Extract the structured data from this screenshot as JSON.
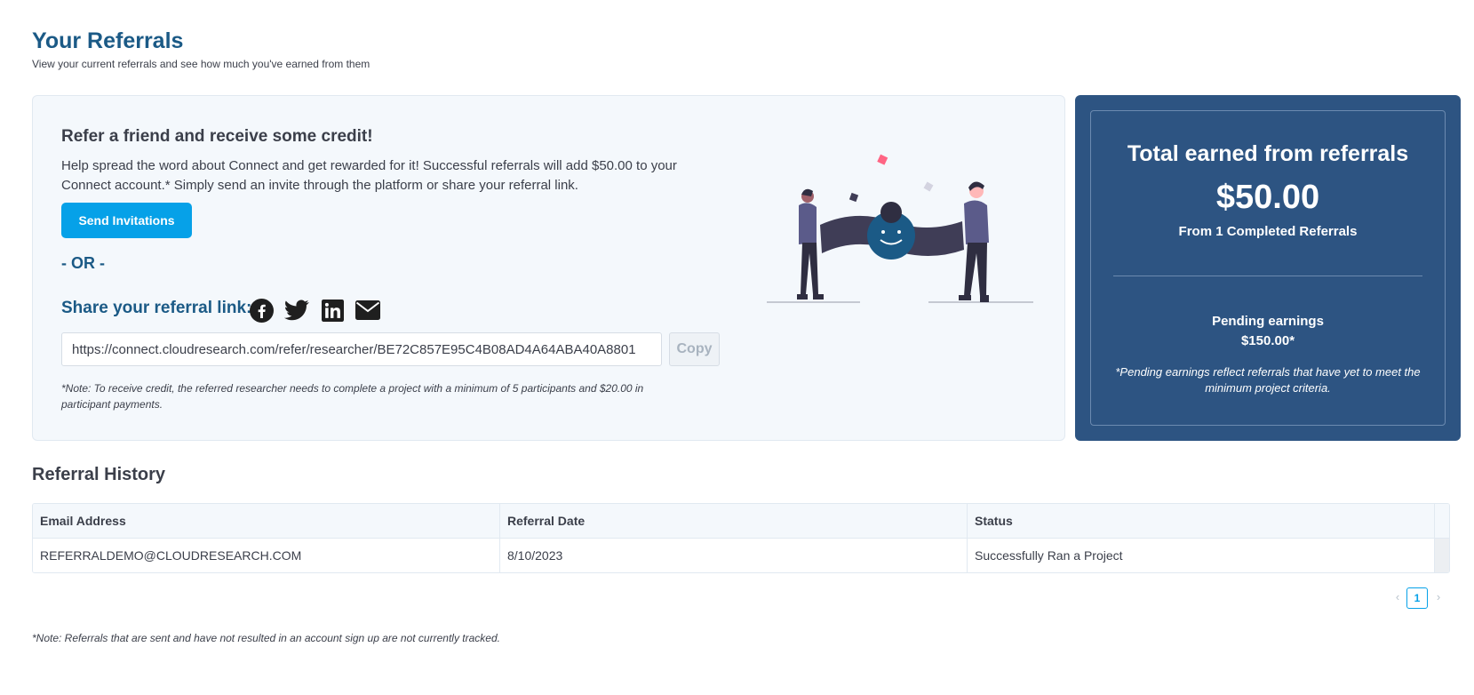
{
  "header": {
    "title": "Your Referrals",
    "subtitle": "View your current referrals and see how much you've earned from them"
  },
  "refer_card": {
    "heading": "Refer a friend and receive some credit!",
    "description": "Help spread the word about Connect and get rewarded for it! Successful referrals will add $50.00 to your Connect account.* Simply send an invite through the platform or share your referral link.",
    "send_button_label": "Send Invitations",
    "or_text": "- OR -",
    "share_label": "Share your referral link:",
    "social_icons": [
      "facebook-icon",
      "twitter-icon",
      "linkedin-icon",
      "email-icon"
    ],
    "referral_link": "https://connect.cloudresearch.com/refer/researcher/BE72C857E95C4B08AD4A64ABA40A8801",
    "copy_label": "Copy",
    "note": "*Note: To receive credit, the referred researcher needs to complete a project with a minimum of 5 participants and $20.00 in participant payments."
  },
  "earnings": {
    "title": "Total earned from referrals",
    "amount": "$50.00",
    "completed": "From 1 Completed Referrals",
    "pending_label": "Pending earnings",
    "pending_amount": "$150.00*",
    "pending_note": "*Pending earnings reflect referrals that have yet to meet the minimum project criteria."
  },
  "history": {
    "title": "Referral History",
    "columns": [
      "Email Address",
      "Referral Date",
      "Status"
    ],
    "rows": [
      [
        "REFERRALDEMO@CLOUDRESEARCH.COM",
        "8/10/2023",
        "Successfully Ran a Project"
      ]
    ],
    "pagination": {
      "prev": "‹",
      "current_page": "1",
      "next": "›"
    }
  },
  "footer_note": "*Note: Referrals that are sent and have not resulted in an account sign up are not currently tracked.",
  "colors": {
    "primary_blue": "#1b5a86",
    "button_blue": "#06a1e8",
    "earnings_panel": "#2d5482",
    "card_background": "#f4f8fc"
  }
}
